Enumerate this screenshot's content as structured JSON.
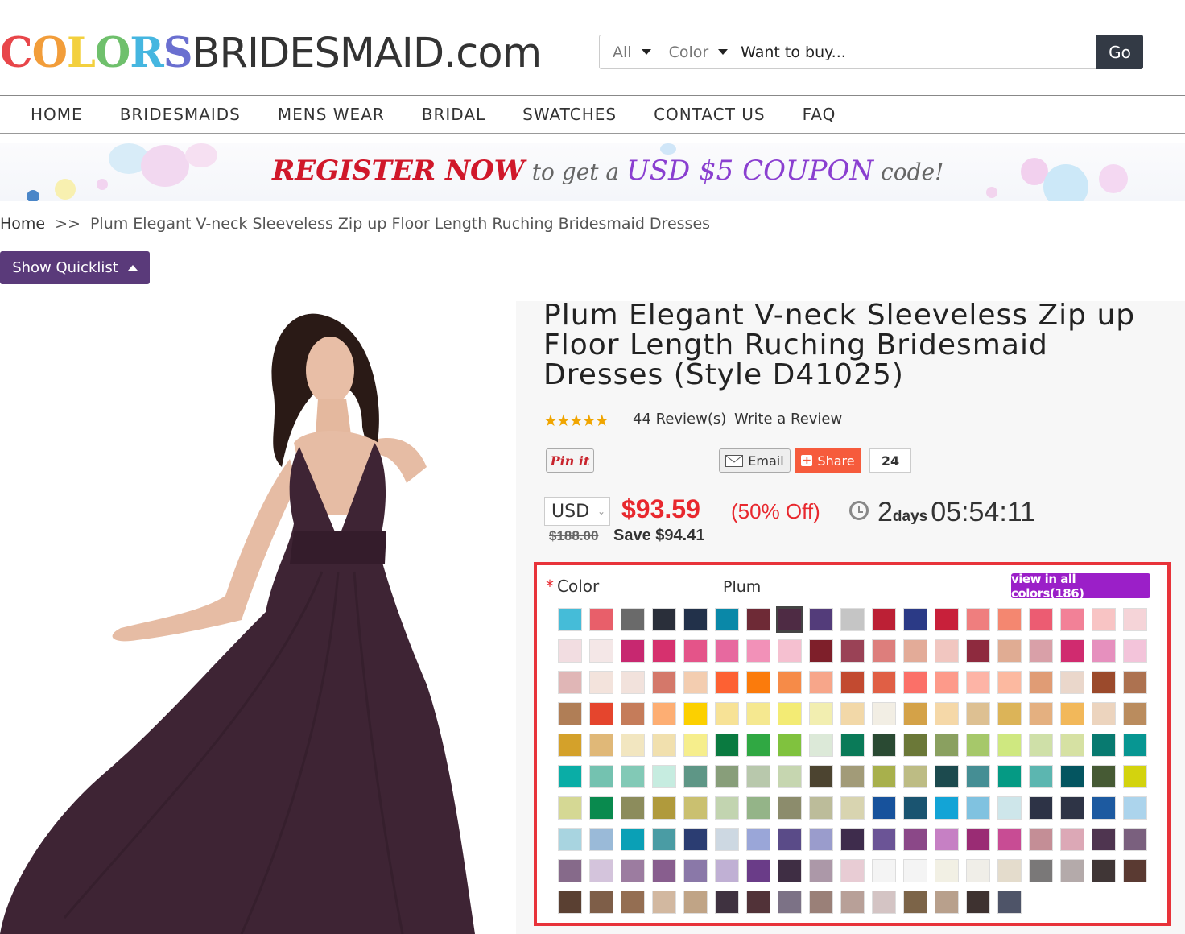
{
  "logo": {
    "colors_text": "COLORS",
    "colors_palette": [
      "#e8464a",
      "#f29d3a",
      "#f3d03e",
      "#6fc06c",
      "#45b6e0",
      "#6a6fd0",
      "#b063c8"
    ],
    "rest_text": "BRIDESMAID.com"
  },
  "search": {
    "filter_all": "All",
    "filter_color": "Color",
    "placeholder": "Want to buy...",
    "go_label": "Go"
  },
  "nav": {
    "items": [
      "HOME",
      "BRIDESMAIDS",
      "MENS WEAR",
      "BRIDAL",
      "SWATCHES",
      "CONTACT US",
      "FAQ"
    ]
  },
  "banner": {
    "part1": "REGISTER NOW",
    "part2": " to get a ",
    "part3": "USD $5 COUPON",
    "part4": " code!"
  },
  "breadcrumb": {
    "home": "Home",
    "separator": ">>",
    "current": "Plum Elegant V-neck Sleeveless Zip up Floor Length Ruching Bridesmaid Dresses"
  },
  "quicklist": {
    "label": "Show Quicklist"
  },
  "product": {
    "title": "Plum Elegant V-neck Sleeveless Zip up Floor Length Ruching Bridesmaid Dresses (Style D41025)",
    "stars": "★★★★★",
    "reviews": "44 Review(s)",
    "write_review": "Write a Review",
    "pin_label": "Pin it",
    "email_label": "Email",
    "share_label": "Share",
    "share_count": "24",
    "currency": "USD",
    "price": "$93.59",
    "discount": "(50% Off)",
    "timer_days": "2",
    "timer_days_label": "days",
    "timer_time": "05:54:11",
    "original_price": "$188.00",
    "save_text": "Save $94.41",
    "dress_color": "#3e2434"
  },
  "color_picker": {
    "label": "Color",
    "required_mark": "*",
    "selected_name": "Plum",
    "view_all_label": "view in all colors(186)",
    "selected_index": 7,
    "swatches": [
      "#45bcd8",
      "#e85f6a",
      "#6a6a6a",
      "#2a2f3a",
      "#22314a",
      "#0a88a8",
      "#6e2a36",
      "#4e2b44",
      "#533c7a",
      "#c5c5c5",
      "#bc2035",
      "#2b3a86",
      "#c8203a",
      "#ef7e7e",
      "#f48770",
      "#ec5c72",
      "#f28197",
      "#f8c4c4",
      "#f5d4d8",
      "#f2dde1",
      "#f4e7e7",
      "#c72870",
      "#d6316e",
      "#e45489",
      "#e7699f",
      "#f291b8",
      "#f5c0d0",
      "#7e1f2a",
      "#9a4256",
      "#dd7e7c",
      "#e3ab98",
      "#f1c6c0",
      "#8e2a3e",
      "#e0ac93",
      "#d9a0a8",
      "#d02b6f",
      "#e690be",
      "#f3c4da",
      "#e0b6b6",
      "#f3e3dc",
      "#f2e2dc",
      "#d4786a",
      "#f3cdb0",
      "#fd6133",
      "#fb7b0c",
      "#f68b48",
      "#f7a68a",
      "#c24a30",
      "#e05f45",
      "#fb7068",
      "#fd9a8a",
      "#fdb4a6",
      "#fcb9a0",
      "#e09c75",
      "#ead7cb",
      "#9b4a2c",
      "#ad7250",
      "#b07e56",
      "#e5452d",
      "#c57c5a",
      "#fdae73",
      "#fcd000",
      "#f7e296",
      "#f5e890",
      "#f3eb74",
      "#f2eeb0",
      "#f2d8a8",
      "#f2eee4",
      "#d4a248",
      "#f5d8a8",
      "#ddc092",
      "#dcb458",
      "#e4b080",
      "#f2b85a",
      "#ecd4be",
      "#ba8c5e",
      "#d4a12a",
      "#e0b878",
      "#f2e6c0",
      "#f1e0ae",
      "#f6ee8c",
      "#0a7a40",
      "#30a843",
      "#80c23e",
      "#dce9d8",
      "#0a7a58",
      "#2a4a33",
      "#6b7838",
      "#8aa060",
      "#a6c86a",
      "#cfe880",
      "#cfe0a8",
      "#d6e1a3",
      "#087a70",
      "#079692",
      "#0aada6",
      "#74c2b0",
      "#82c9b6",
      "#c6ece0",
      "#5e9686",
      "#889e7a",
      "#b8c8ac",
      "#c6d6b0",
      "#4c4430",
      "#a29b78",
      "#a8b04c",
      "#bdbc84",
      "#1c4a4e",
      "#458e94",
      "#059a84",
      "#5cb6b0",
      "#045560",
      "#465a34",
      "#d3d30e",
      "#d5d894",
      "#098a4e",
      "#8c8c5c",
      "#b09a3c",
      "#cac070",
      "#c2d4b0",
      "#94b488",
      "#8c8c6c",
      "#bcbc9a",
      "#d8d4b0",
      "#17529c",
      "#1a5470",
      "#13a4d6",
      "#80c2e0",
      "#cee6ea",
      "#2d3346",
      "#2e3446",
      "#1d5aa0",
      "#acd4ec",
      "#a8d4e0",
      "#9abad8",
      "#0aa0b6",
      "#4a9ca4",
      "#2b3d72",
      "#cdd8e2",
      "#9aa6d8",
      "#5a4b88",
      "#9a9ccc",
      "#3e2c4c",
      "#6b5496",
      "#8b4888",
      "#c680c4",
      "#9a2c74",
      "#c84c94",
      "#c48e96",
      "#dca8b6",
      "#4f3550",
      "#7a607e",
      "#866a8a",
      "#d4c4dc",
      "#9c7ca0",
      "#885e8e",
      "#8a78a8",
      "#c0b0d4",
      "#6a3c88",
      "#3f2e44",
      "#ac98a8",
      "#e8ccd4",
      "#f4f4f4",
      "#f4f4f4",
      "#f2f0e4",
      "#f0eee8",
      "#e4dccc",
      "#7a7878",
      "#b4aaaa",
      "#403636",
      "#5a3a32",
      "#5a4032",
      "#7e5e48",
      "#946e52",
      "#d2b8a0",
      "#c0a486",
      "#3f3240",
      "#513238",
      "#7c7286",
      "#9a8078",
      "#b8a098",
      "#d4c4c4",
      "#7c6448",
      "#b8a08c",
      "#3e3230",
      "#4e5468"
    ]
  }
}
